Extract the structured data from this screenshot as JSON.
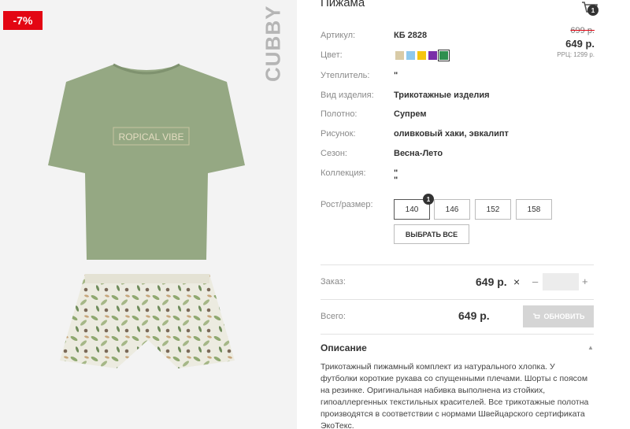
{
  "badge": {
    "discount": "-7%"
  },
  "brand": {
    "vertical": "CUBBY"
  },
  "product": {
    "print_text": "ROPICAL VIBE",
    "title": "Пижама"
  },
  "header": {
    "cart_count": "1"
  },
  "details": {
    "article_label": "Артикул:",
    "article_value": "КБ 2828",
    "color_label": "Цвет:",
    "warming_label": "Утеплитель:",
    "warming_value": "\"",
    "type_label": "Вид изделия:",
    "type_value": "Трикотажные изделия",
    "fabric_label": "Полотно:",
    "fabric_value": "Супрем",
    "pattern_label": "Рисунок:",
    "pattern_value": "оливковый хаки, эвкалипт",
    "season_label": "Сезон:",
    "season_value": "Весна-Лето",
    "collection_label": "Коллекция:",
    "collection_value_1": "\"",
    "collection_value_2": "\""
  },
  "price": {
    "old": "699 р.",
    "current": "649 р.",
    "rrc": "РРЦ: 1299 р."
  },
  "colors": {
    "swatches": [
      "#d9cba7",
      "#8ec9ee",
      "#f5c50f",
      "#7a2fa8",
      "#2f8f4e"
    ],
    "selected_index": 4
  },
  "sizes": {
    "label": "Рост/размер:",
    "options": [
      "140",
      "146",
      "152",
      "158"
    ],
    "selected": "140",
    "selected_count": "1",
    "select_all": "ВЫБРАТЬ ВСЕ"
  },
  "order": {
    "label": "Заказ:",
    "price": "649 р.",
    "times": "×",
    "minus": "–",
    "plus": "+",
    "qty_value": ""
  },
  "total": {
    "label": "Всего:",
    "price": "649 р.",
    "update_label": "ОБНОВИТЬ"
  },
  "description": {
    "title": "Описание",
    "text": "Трикотажный пижамный комплект из натурального хлопка. У футболки короткие рукава со спущенными плечами. Шорты с поясом на резинке. Оригинальная набивка выполнена из стойких, гипоаллергенных текстильных красителей. Все трикотажные полотна производятся в соответствии с нормами Швейцарского сертификата ЭкоТекс."
  },
  "icons": {
    "cart": "cart-icon",
    "collapse": "chevron-up-icon",
    "update": "cart-icon"
  }
}
